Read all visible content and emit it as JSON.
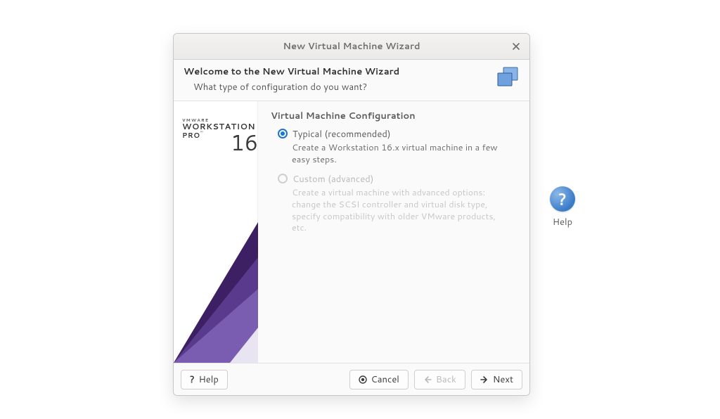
{
  "desktop": {
    "help_label": "Help"
  },
  "dialog": {
    "title": "New Virtual Machine Wizard",
    "heading": "Welcome to the New Virtual Machine Wizard",
    "subheading": "What type of configuration do you want?",
    "banner": {
      "brand_small": "VMWARE",
      "brand_main": "WORKSTATION",
      "brand_sub": "PRO",
      "tm": "™",
      "version": "16"
    },
    "config": {
      "section_title": "Virtual Machine Configuration",
      "options": [
        {
          "label": "Typical (recommended)",
          "desc": "Create a Workstation 16.x virtual machine in a few easy steps.",
          "selected": true,
          "enabled": true
        },
        {
          "label": "Custom (advanced)",
          "desc": "Create a virtual machine with advanced options: change the SCSI controller and virtual disk type, specify compatibility with older VMware products, etc.",
          "selected": false,
          "enabled": false
        }
      ]
    },
    "buttons": {
      "help": "Help",
      "cancel": "Cancel",
      "back": "Back",
      "next": "Next"
    }
  }
}
